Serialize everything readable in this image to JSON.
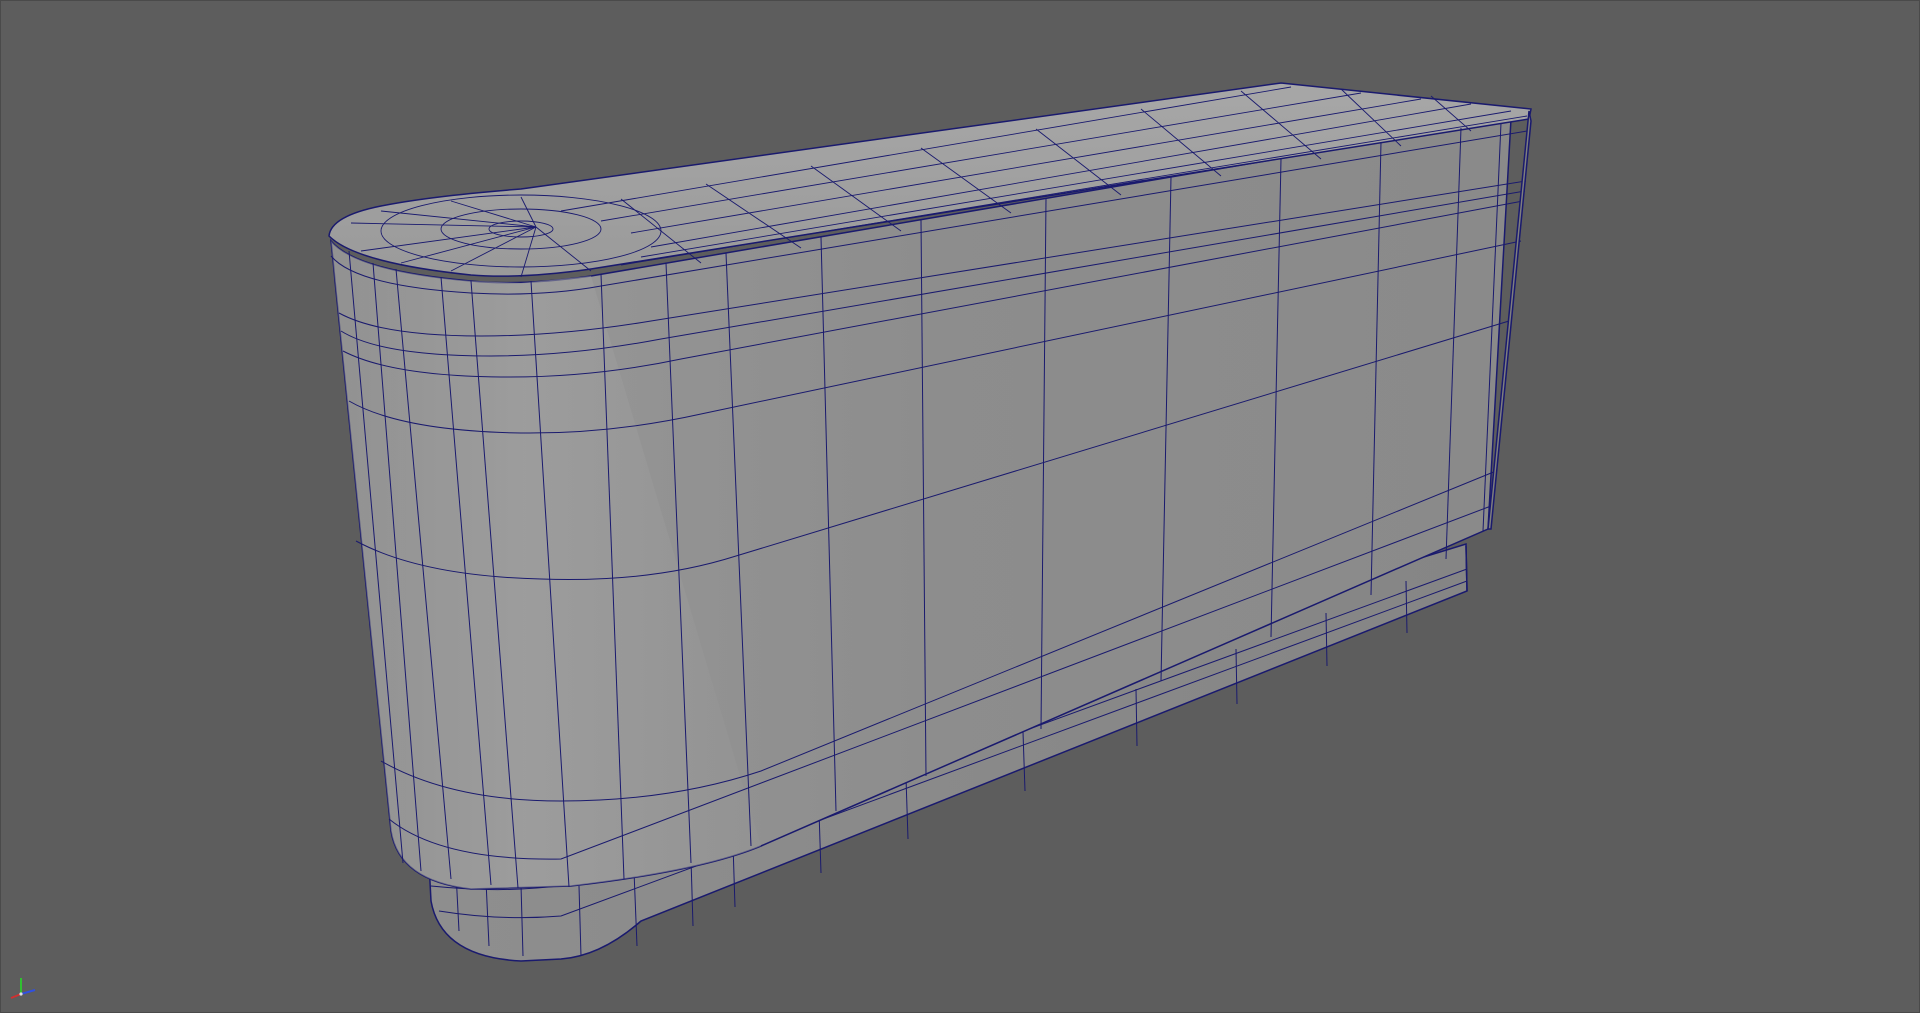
{
  "viewport": {
    "background_color": "#5d5d5d",
    "wireframe_color": "#1a1a6e",
    "object_fill_color": "#8e8e8e",
    "object_name": "",
    "display_mode": "wireframe-on-shaded"
  },
  "axis_gizmo": {
    "x_color": "#d03030",
    "y_color": "#30c030",
    "z_color": "#3050e0",
    "icon": "axis-gizmo-icon"
  }
}
